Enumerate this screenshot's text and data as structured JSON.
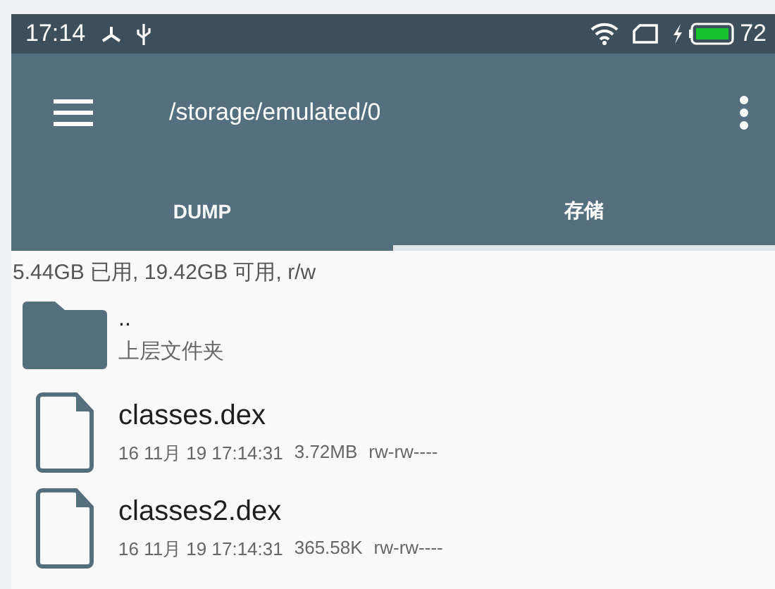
{
  "status_bar": {
    "time": "17:14",
    "battery_level": "72"
  },
  "app_bar": {
    "title": "/storage/emulated/0"
  },
  "tabs": [
    {
      "label": "DUMP",
      "selected": false
    },
    {
      "label": "存储",
      "selected": true
    }
  ],
  "storage_info": "5.44GB 已用, 19.42GB 可用, r/w",
  "files": [
    {
      "kind": "folder",
      "name": "..",
      "detail": "上层文件夹"
    },
    {
      "kind": "file",
      "name": "classes.dex",
      "date": "16 11月 19 17:14:31",
      "size": "3.72MB",
      "permissions": "rw-rw----"
    },
    {
      "kind": "file",
      "name": "classes2.dex",
      "date": "16 11月 19 17:14:31",
      "size": "365.58K",
      "permissions": "rw-rw----"
    }
  ]
}
